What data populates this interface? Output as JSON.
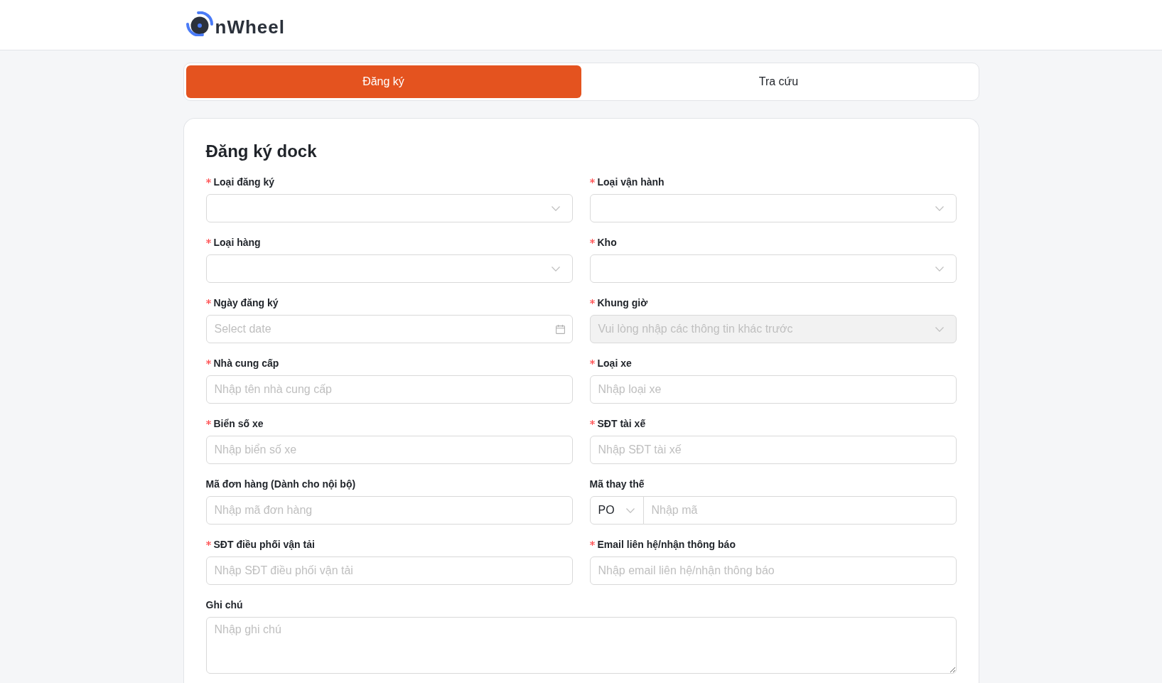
{
  "header": {
    "logo_text": "nWheel"
  },
  "tabs": [
    {
      "label": "Đăng ký",
      "selected": true
    },
    {
      "label": "Tra cứu",
      "selected": false
    }
  ],
  "form": {
    "title": "Đăng ký dock",
    "fields": [
      {
        "label": "Loại đăng ký",
        "required": true,
        "kind": "select",
        "disabled": false
      },
      {
        "label": "Loại vận hành",
        "required": true,
        "kind": "select",
        "disabled": false
      },
      {
        "label": "Loại hàng",
        "required": true,
        "kind": "select",
        "disabled": false
      },
      {
        "label": "Kho",
        "required": true,
        "kind": "select",
        "disabled": false
      },
      {
        "label": "Ngày đăng ký",
        "required": true,
        "kind": "date",
        "placeholder": "Select date",
        "disabled": false
      },
      {
        "label": "Khung giờ",
        "required": true,
        "kind": "select",
        "placeholder": "Vui lòng nhập các thông tin khác trước",
        "disabled": true
      },
      {
        "label": "Nhà cung cấp",
        "required": true,
        "kind": "text",
        "placeholder": "Nhập tên nhà cung cấp",
        "disabled": false
      },
      {
        "label": "Loại xe",
        "required": true,
        "kind": "text",
        "placeholder": "Nhập loại xe",
        "disabled": false
      },
      {
        "label": "Biển số xe",
        "required": true,
        "kind": "text",
        "placeholder": "Nhập biển số xe",
        "disabled": false
      },
      {
        "label": "SĐT tài xế",
        "required": true,
        "kind": "text",
        "placeholder": "Nhập SĐT tài xế",
        "disabled": false
      },
      {
        "label": "Mã đơn hàng (Dành cho nội bộ)",
        "required": false,
        "kind": "text",
        "placeholder": "Nhập mã đơn hàng",
        "disabled": false
      },
      {
        "label": "Mã thay thế",
        "required": false,
        "kind": "prefixed",
        "prefix": "PO",
        "placeholder": "Nhập mã",
        "disabled": false
      },
      {
        "label": "SĐT điều phối vận tải",
        "required": true,
        "kind": "text",
        "placeholder": "Nhập SĐT điều phối vận tải",
        "disabled": false
      },
      {
        "label": "Email liên hệ/nhận thông báo",
        "required": true,
        "kind": "text",
        "placeholder": "Nhập email liên hệ/nhận thông báo",
        "disabled": false
      },
      {
        "label": "Ghi chú",
        "required": false,
        "kind": "textarea",
        "placeholder": "Nhập ghi chú",
        "disabled": false
      }
    ]
  }
}
